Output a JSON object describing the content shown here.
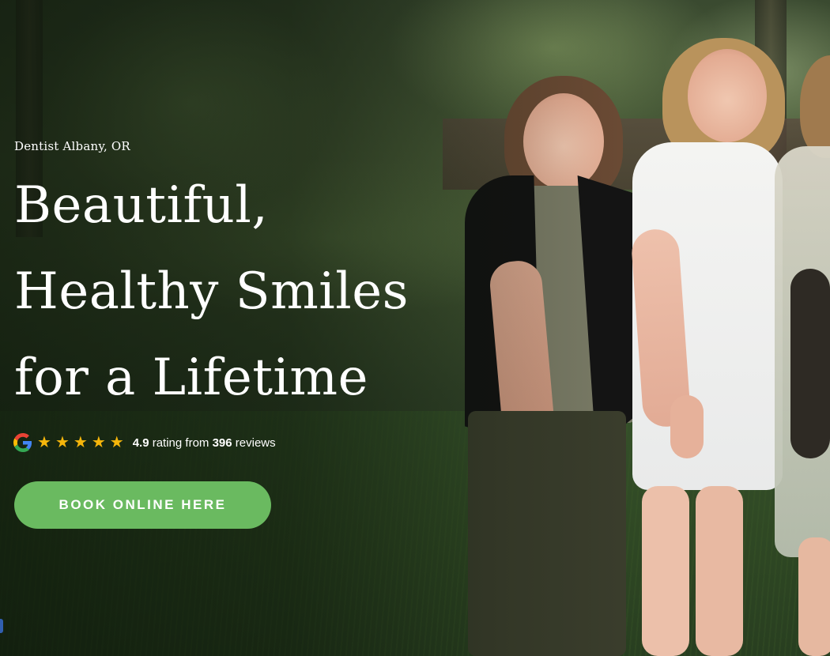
{
  "hero": {
    "eyebrow": "Dentist Albany, OR",
    "headline": [
      "Beautiful,",
      "Healthy Smiles",
      "for a Lifetime"
    ],
    "rating": {
      "icon": "google-icon",
      "stars": 5,
      "score": "4.9",
      "text_mid": " rating from ",
      "count": "396",
      "text_end": " reviews",
      "star_color": "#f6b60b"
    },
    "cta_label": "BOOK ONLINE HERE",
    "cta_color": "#6aba60"
  }
}
